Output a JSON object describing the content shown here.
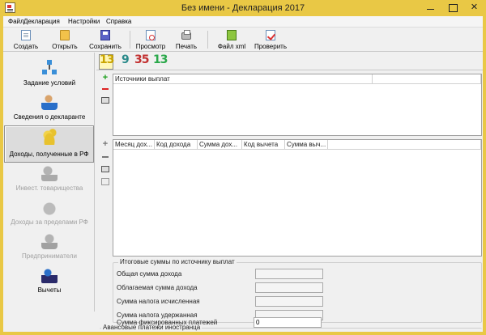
{
  "window": {
    "title": "Без имени - Декларация 2017"
  },
  "menu": [
    "Файл",
    "Декларация",
    "Настройки",
    "Справка"
  ],
  "toolbar": {
    "buttons": [
      {
        "label": "Создать",
        "icon": "new-document-icon"
      },
      {
        "label": "Открыть",
        "icon": "open-folder-icon"
      },
      {
        "label": "Сохранить",
        "icon": "floppy-disk-icon"
      },
      {
        "label": "Просмотр",
        "icon": "preview-icon"
      },
      {
        "label": "Печать",
        "icon": "printer-icon"
      },
      {
        "label": "Файл xml",
        "icon": "xml-file-icon"
      },
      {
        "label": "Проверить",
        "icon": "check-icon"
      }
    ]
  },
  "sidebar": {
    "items": [
      {
        "label": "Задание условий",
        "icon": "conditions-icon",
        "state": "normal"
      },
      {
        "label": "Сведения о декларанте",
        "icon": "person-icon",
        "state": "normal"
      },
      {
        "label": "Доходы, полученные в РФ",
        "icon": "coins-icon",
        "state": "active"
      },
      {
        "label": "Инвест. товарищества",
        "icon": "investor-icon",
        "state": "disabled"
      },
      {
        "label": "Доходы за пределами РФ",
        "icon": "money-bag-icon",
        "state": "disabled"
      },
      {
        "label": "Предприниматели",
        "icon": "businessman-icon",
        "state": "disabled"
      },
      {
        "label": "Вычеты",
        "icon": "deductions-icon",
        "state": "normal"
      }
    ]
  },
  "tax_rates": [
    "13",
    "9",
    "35",
    "13"
  ],
  "colors": {
    "rate_13": "#c9a400",
    "rate_9": "#2b8a8a",
    "rate_35": "#c23030",
    "rate_13_nonres": "#2aa84a"
  },
  "sources_table": {
    "headers": [
      "Источники выплат"
    ]
  },
  "income_table": {
    "headers": [
      "Месяц дох...",
      "Код дохода",
      "Сумма дох...",
      "Код вычета",
      "Сумма выч..."
    ]
  },
  "totals": {
    "title": "Итоговые суммы по источнику выплат",
    "fields": [
      {
        "label": "Общая сумма дохода",
        "value": ""
      },
      {
        "label": "Облагаемая сумма дохода",
        "value": ""
      },
      {
        "label": "Сумма налога исчисленная",
        "value": ""
      },
      {
        "label": "Сумма налога удержанная",
        "value": ""
      }
    ]
  },
  "advance": {
    "title": "Авансовые платежи иностранца",
    "label": "Сумма фиксированных платежей",
    "value": "0"
  }
}
